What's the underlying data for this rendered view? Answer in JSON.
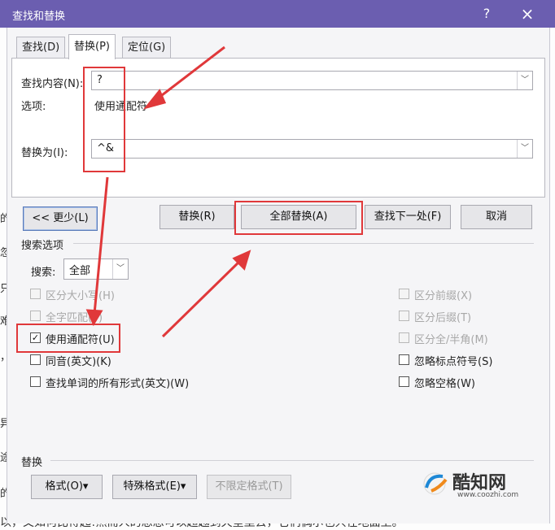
{
  "window": {
    "title": "查找和替换",
    "help_glyph": "?",
    "close_glyph": "×"
  },
  "tabs": [
    {
      "label": "查找(D)"
    },
    {
      "label": "替换(P)"
    },
    {
      "label": "定位(G)"
    }
  ],
  "find": {
    "label": "查找内容(N):",
    "value": "?",
    "options_label": "选项:",
    "options_value": "使用通配符"
  },
  "replace": {
    "label": "替换为(I):",
    "value": "^&"
  },
  "buttons": {
    "less": "<< 更少(L)",
    "replace": "替换(R)",
    "replace_all": "全部替换(A)",
    "find_next": "查找下一处(F)",
    "cancel": "取消"
  },
  "search_options": {
    "heading": "搜索选项",
    "search_label": "搜索:",
    "search_value": "全部"
  },
  "checkboxes_left": [
    {
      "label": "区分大小写(H)",
      "checked": false,
      "enabled": false
    },
    {
      "label": "全字匹配(Y)",
      "checked": false,
      "enabled": false
    },
    {
      "label": "使用通配符(U)",
      "checked": true,
      "enabled": true
    },
    {
      "label": "同音(英文)(K)",
      "checked": false,
      "enabled": true
    },
    {
      "label": "查找单词的所有形式(英文)(W)",
      "checked": false,
      "enabled": true
    }
  ],
  "checkboxes_right": [
    {
      "label": "区分前缀(X)",
      "checked": false,
      "enabled": false
    },
    {
      "label": "区分后缀(T)",
      "checked": false,
      "enabled": false
    },
    {
      "label": "区分全/半角(M)",
      "checked": false,
      "enabled": false
    },
    {
      "label": "忽略标点符号(S)",
      "checked": false,
      "enabled": true
    },
    {
      "label": "忽略空格(W)",
      "checked": false,
      "enabled": true
    }
  ],
  "replace_section": {
    "heading": "替换",
    "format_button": "格式(O)▾",
    "special_button": "特殊格式(E)▾",
    "no_format_button": "不限定格式(T)"
  },
  "watermark": {
    "name": "酷知网",
    "url": "www.coozhi.com"
  },
  "background_text": {
    "line": "以，又如何比得起!然而人的想想可以超越到天堂里去，它们偶尔也只在地面上。"
  },
  "colors": {
    "titlebar": "#6b5eb0",
    "annotation_red": "#e0383a",
    "dialog_bg": "#f5f5f7"
  }
}
